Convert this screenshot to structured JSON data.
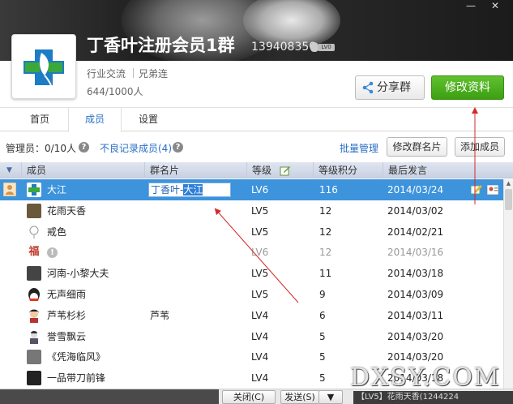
{
  "window": {
    "minimize_glyph": "—",
    "close_glyph": "✕"
  },
  "group": {
    "name": "丁香叶注册会员1群",
    "id": "139408350",
    "level_badge": "LV0",
    "tags": [
      "行业交流",
      "兄弟连"
    ],
    "member_count": "644/1000人"
  },
  "actions": {
    "share_label": "分享群",
    "edit_label": "修改资料"
  },
  "tabs": [
    {
      "label": "首页",
      "active": false
    },
    {
      "label": "成员",
      "active": true
    },
    {
      "label": "设置",
      "active": false
    }
  ],
  "toolbar": {
    "admin_label": "管理员：0/10人",
    "bad_record_link": "不良记录成员(4)",
    "batch_manage_link": "批量管理",
    "edit_card_button": "修改群名片",
    "add_member_button": "添加成员"
  },
  "table": {
    "columns": [
      "成员",
      "群名片",
      "等级",
      "等级积分",
      "最后发言"
    ],
    "editing_card_value": "丁香叶-大江",
    "editing_card_selected": "大江",
    "rows": [
      {
        "name": "大江",
        "card": "",
        "level": "LV6",
        "score": "116",
        "last": "2014/03/24",
        "selected": true,
        "muted": false,
        "avatar_color": "#2a8f5a"
      },
      {
        "name": "花雨天香",
        "card": "",
        "level": "LV5",
        "score": "12",
        "last": "2014/03/02",
        "selected": false,
        "muted": false,
        "avatar_color": "#6b5a3a"
      },
      {
        "name": "戒色",
        "card": "",
        "level": "LV5",
        "score": "12",
        "last": "2014/02/21",
        "selected": false,
        "muted": false,
        "avatar_color": "#d9d9d9"
      },
      {
        "name": "",
        "card": "",
        "level": "LV6",
        "score": "12",
        "last": "2014/03/16",
        "selected": false,
        "muted": true,
        "avatar_color": "#c0392b"
      },
      {
        "name": "河南-小黎大夫",
        "card": "",
        "level": "LV5",
        "score": "11",
        "last": "2014/03/18",
        "selected": false,
        "muted": false,
        "avatar_color": "#444"
      },
      {
        "name": "无声细雨",
        "card": "",
        "level": "LV5",
        "score": "9",
        "last": "2014/03/09",
        "selected": false,
        "muted": false,
        "avatar_color": "#e03a1e"
      },
      {
        "name": "芦苇杉杉",
        "card": "芦苇",
        "level": "LV4",
        "score": "6",
        "last": "2014/03/11",
        "selected": false,
        "muted": false,
        "avatar_color": "#333"
      },
      {
        "name": "誉雪飘云",
        "card": "",
        "level": "LV4",
        "score": "5",
        "last": "2014/03/20",
        "selected": false,
        "muted": false,
        "avatar_color": "#556"
      },
      {
        "name": "《凭海临风》",
        "card": "",
        "level": "LV4",
        "score": "5",
        "last": "2014/03/20",
        "selected": false,
        "muted": false,
        "avatar_color": "#555"
      },
      {
        "name": "一品带刀前锋",
        "card": "",
        "level": "LV4",
        "score": "5",
        "last": "2014/03/18",
        "selected": false,
        "muted": false,
        "avatar_color": "#222"
      }
    ]
  },
  "bottom": {
    "close_label": "关闭(C)",
    "send_label": "发送(S)",
    "send_dropdown": "▼",
    "notify_text": "【LV5】花雨天香(1244224"
  },
  "watermark": "DXSY.COM",
  "colors": {
    "accent_blue": "#2a6fc9",
    "selected_row": "#3d93dc",
    "green_button": "#4caf20",
    "annotation_red": "#d42a2a"
  }
}
